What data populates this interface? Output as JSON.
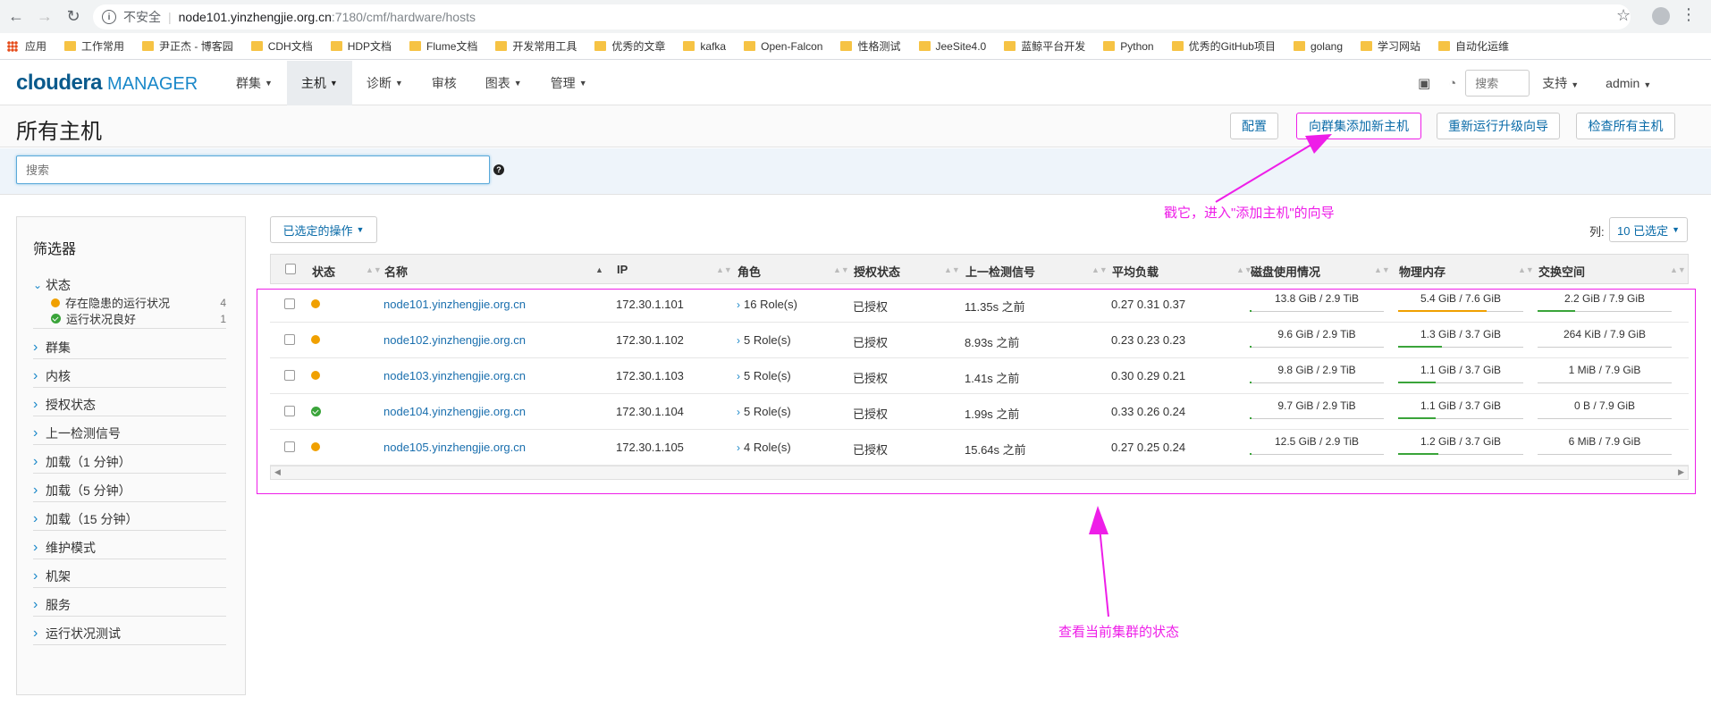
{
  "browser": {
    "insecure": "不安全",
    "url_host": "node101.yinzhengjie.org.cn",
    "url_path": ":7180/cmf/hardware/hosts",
    "bookmarks": [
      "应用",
      "工作常用",
      "尹正杰 - 博客园",
      "CDH文档",
      "HDP文档",
      "Flume文档",
      "开发常用工具",
      "优秀的文章",
      "kafka",
      "Open-Falcon",
      "性格测试",
      "JeeSite4.0",
      "蓝鲸平台开发",
      "Python",
      "优秀的GitHub项目",
      "golang",
      "学习网站",
      "自动化运维"
    ]
  },
  "header": {
    "brand": "cloudera",
    "product": "MANAGER",
    "nav": [
      "群集",
      "主机",
      "诊断",
      "审核",
      "图表",
      "管理"
    ],
    "search_placeholder": "搜索",
    "support": "支持",
    "user": "admin"
  },
  "titlebar": {
    "title": "所有主机",
    "buttons": [
      "配置",
      "向群集添加新主机",
      "重新运行升级向导",
      "检查所有主机"
    ]
  },
  "search": {
    "placeholder": "搜索"
  },
  "filters": {
    "title": "筛选器",
    "status_label": "状态",
    "status_items": [
      {
        "label": "存在隐患的运行状况",
        "count": "4",
        "state": "warning"
      },
      {
        "label": "运行状况良好",
        "count": "1",
        "state": "good"
      }
    ],
    "facets": [
      "群集",
      "内核",
      "授权状态",
      "上一检测信号",
      "加载（1 分钟）",
      "加载（5 分钟）",
      "加载（15 分钟）",
      "维护模式",
      "机架",
      "服务",
      "运行状况测试"
    ]
  },
  "table": {
    "ops_label": "已选定的操作",
    "cols_prefix": "列:",
    "cols_btn": "10 已选定",
    "headers": [
      "状态",
      "名称",
      "IP",
      "角色",
      "授权状态",
      "上一检测信号",
      "平均负载",
      "磁盘使用情况",
      "物理内存",
      "交换空间"
    ],
    "rows": [
      {
        "state": "warning",
        "name": "node101.yinzhengjie.org.cn",
        "ip": "172.30.1.101",
        "roles": "16 Role(s)",
        "auth": "已授权",
        "heartbeat": "11.35s 之前",
        "load": "0.27  0.31  0.37",
        "disk": "13.8 GiB / 2.9 TiB",
        "disk_frac": 0.005,
        "mem": "5.4 GiB / 7.6 GiB",
        "mem_frac": 0.71,
        "swap": "2.2 GiB / 7.9 GiB",
        "swap_frac": 0.28
      },
      {
        "state": "warning",
        "name": "node102.yinzhengjie.org.cn",
        "ip": "172.30.1.102",
        "roles": "5 Role(s)",
        "auth": "已授权",
        "heartbeat": "8.93s 之前",
        "load": "0.23  0.23  0.23",
        "disk": "9.6 GiB / 2.9 TiB",
        "disk_frac": 0.003,
        "mem": "1.3 GiB / 3.7 GiB",
        "mem_frac": 0.35,
        "swap": "264 KiB / 7.9 GiB",
        "swap_frac": 0.0
      },
      {
        "state": "warning",
        "name": "node103.yinzhengjie.org.cn",
        "ip": "172.30.1.103",
        "roles": "5 Role(s)",
        "auth": "已授权",
        "heartbeat": "1.41s 之前",
        "load": "0.30  0.29  0.21",
        "disk": "9.8 GiB / 2.9 TiB",
        "disk_frac": 0.003,
        "mem": "1.1 GiB / 3.7 GiB",
        "mem_frac": 0.3,
        "swap": "1 MiB / 7.9 GiB",
        "swap_frac": 0.0
      },
      {
        "state": "good",
        "name": "node104.yinzhengjie.org.cn",
        "ip": "172.30.1.104",
        "roles": "5 Role(s)",
        "auth": "已授权",
        "heartbeat": "1.99s 之前",
        "load": "0.33  0.26  0.24",
        "disk": "9.7 GiB / 2.9 TiB",
        "disk_frac": 0.003,
        "mem": "1.1 GiB / 3.7 GiB",
        "mem_frac": 0.3,
        "swap": "0 B / 7.9 GiB",
        "swap_frac": 0.0
      },
      {
        "state": "warning",
        "name": "node105.yinzhengjie.org.cn",
        "ip": "172.30.1.105",
        "roles": "4 Role(s)",
        "auth": "已授权",
        "heartbeat": "15.64s 之前",
        "load": "0.27  0.25  0.24",
        "disk": "12.5 GiB / 2.9 TiB",
        "disk_frac": 0.004,
        "mem": "1.2 GiB / 3.7 GiB",
        "mem_frac": 0.32,
        "swap": "6 MiB / 7.9 GiB",
        "swap_frac": 0.0
      }
    ]
  },
  "annotations": {
    "add_host_hint": "戳它，进入\"添加主机\"的向导",
    "status_hint": "查看当前集群的状态",
    "color": "#ee1ee8"
  },
  "colors": {
    "warning": "#f0a000",
    "good": "#3aa43a",
    "mem_warn": "#f0a000",
    "bar_ok": "#3aa43a"
  }
}
